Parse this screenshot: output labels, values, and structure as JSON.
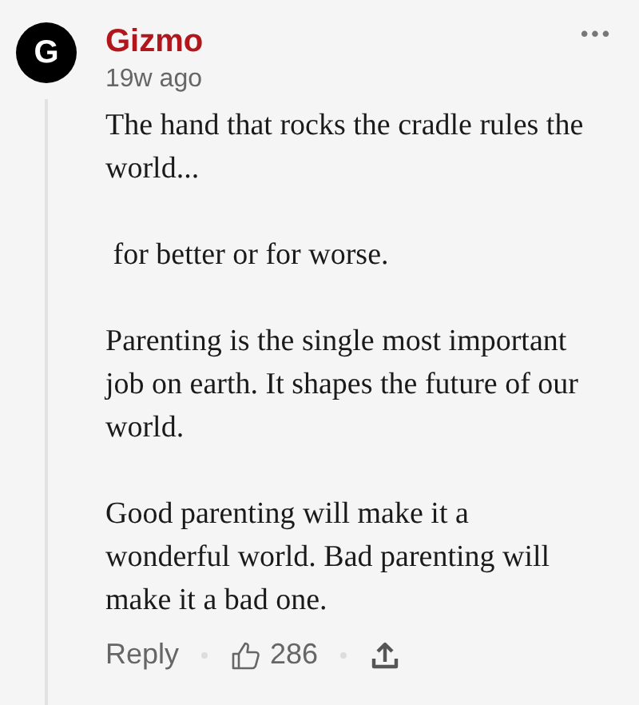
{
  "comment": {
    "avatar_letter": "G",
    "author": "Gizmo",
    "time": "19w ago",
    "menu": "•••",
    "paragraphs": [
      "The hand that rocks the cradle rules the world...",
      " for better or for worse.",
      "Parenting is the single most important job on earth. It shapes the future of our world.",
      "Good parenting will make it a wonderful world. Bad parenting will make it a bad one."
    ],
    "reply_label": "Reply",
    "likes": "286"
  }
}
